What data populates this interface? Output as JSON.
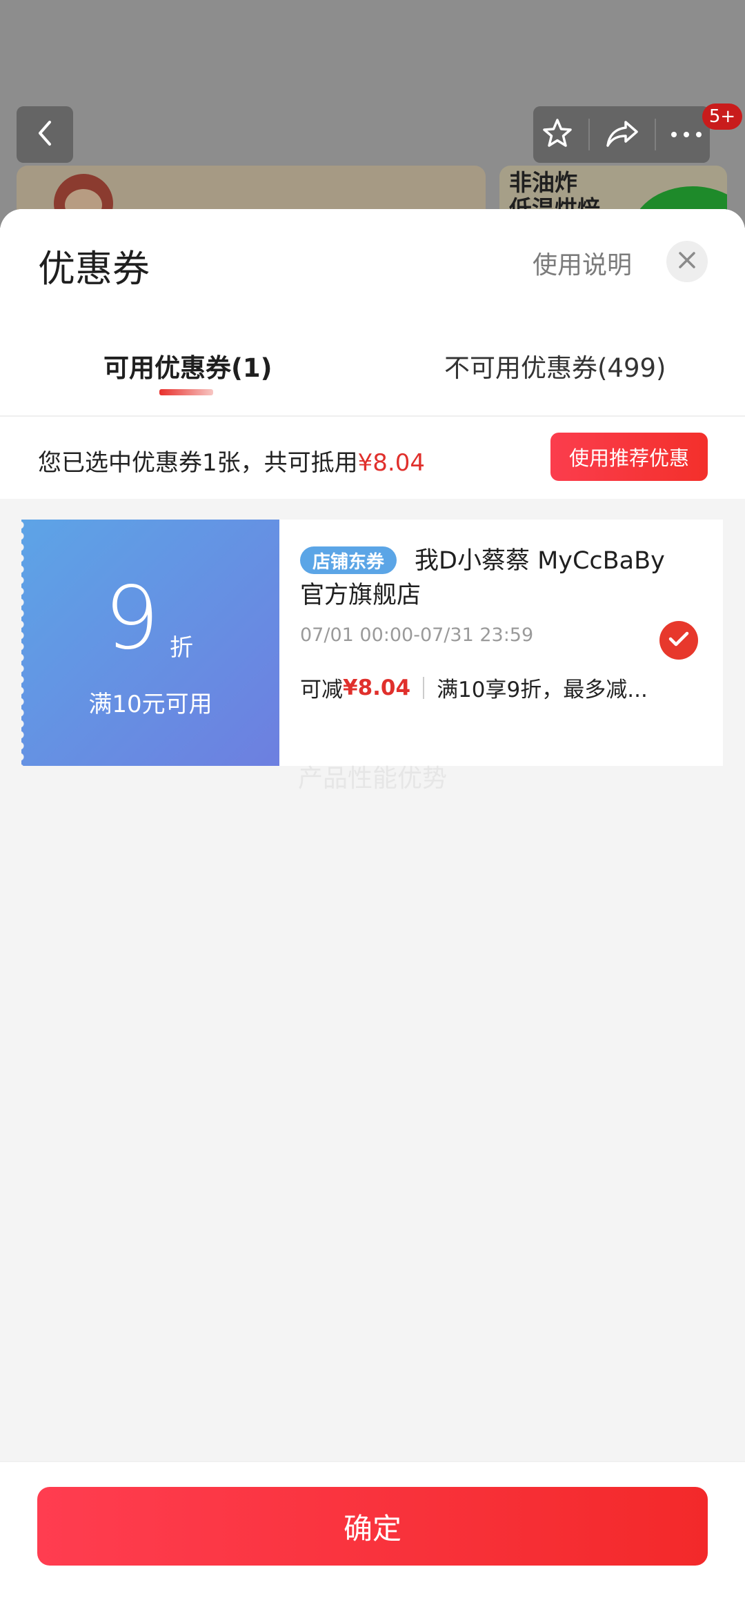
{
  "background_page": {
    "message_badge": "5+",
    "card_text_line1": "非油炸",
    "card_text_line2": "低温烘焙"
  },
  "sheet": {
    "title": "优惠券",
    "help_link": "使用说明",
    "tabs": [
      {
        "label": "可用优惠券(1)",
        "active": true
      },
      {
        "label": "不可用优惠券(499)",
        "active": false
      }
    ],
    "summary": {
      "text": "您已选中优惠券1张，共可抵用",
      "amount": "¥8.04"
    },
    "recommend_button": "使用推荐优惠",
    "coupon": {
      "discount_value": "9",
      "discount_unit": "折",
      "threshold": "满10元可用",
      "badge": "店铺东券",
      "shop_name": "我D小蔡蔡 MyCcBaBy官方旗舰店",
      "valid_time": "07/01 00:00-07/31 23:59",
      "saving_label": "可减",
      "saving_amount": "¥8.04",
      "rule_text": "满10享9折，最多减...",
      "selected": true
    },
    "ghost_text": "产品性能优势",
    "confirm_button": "确定"
  },
  "colors": {
    "accent_red": "#e0302c",
    "coupon_blue": "#5da4e6",
    "badge_blue": "#5ba5e6"
  }
}
